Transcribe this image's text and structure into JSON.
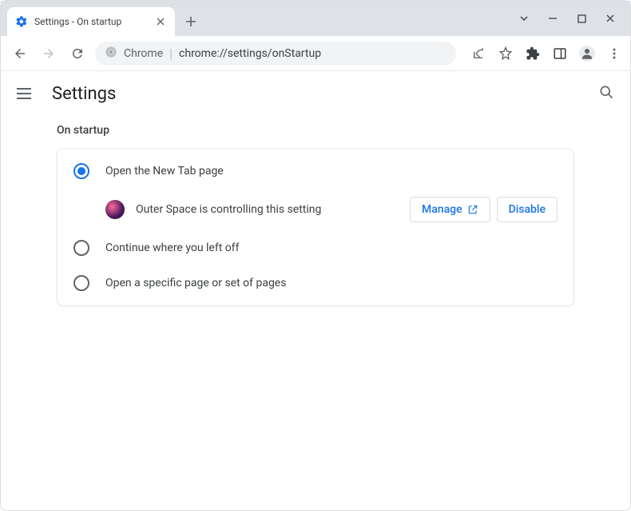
{
  "window": {
    "tab_title": "Settings - On startup"
  },
  "omnibox": {
    "prefix": "Chrome",
    "url": "chrome://settings/onStartup"
  },
  "header": {
    "title": "Settings"
  },
  "section": {
    "title": "On startup",
    "options": [
      {
        "label": "Open the New Tab page",
        "selected": true
      },
      {
        "label": "Continue where you left off",
        "selected": false
      },
      {
        "label": "Open a specific page or set of pages",
        "selected": false
      }
    ],
    "extension": {
      "name": "Outer Space",
      "message": "Outer Space is controlling this setting",
      "manage_label": "Manage",
      "disable_label": "Disable"
    }
  }
}
